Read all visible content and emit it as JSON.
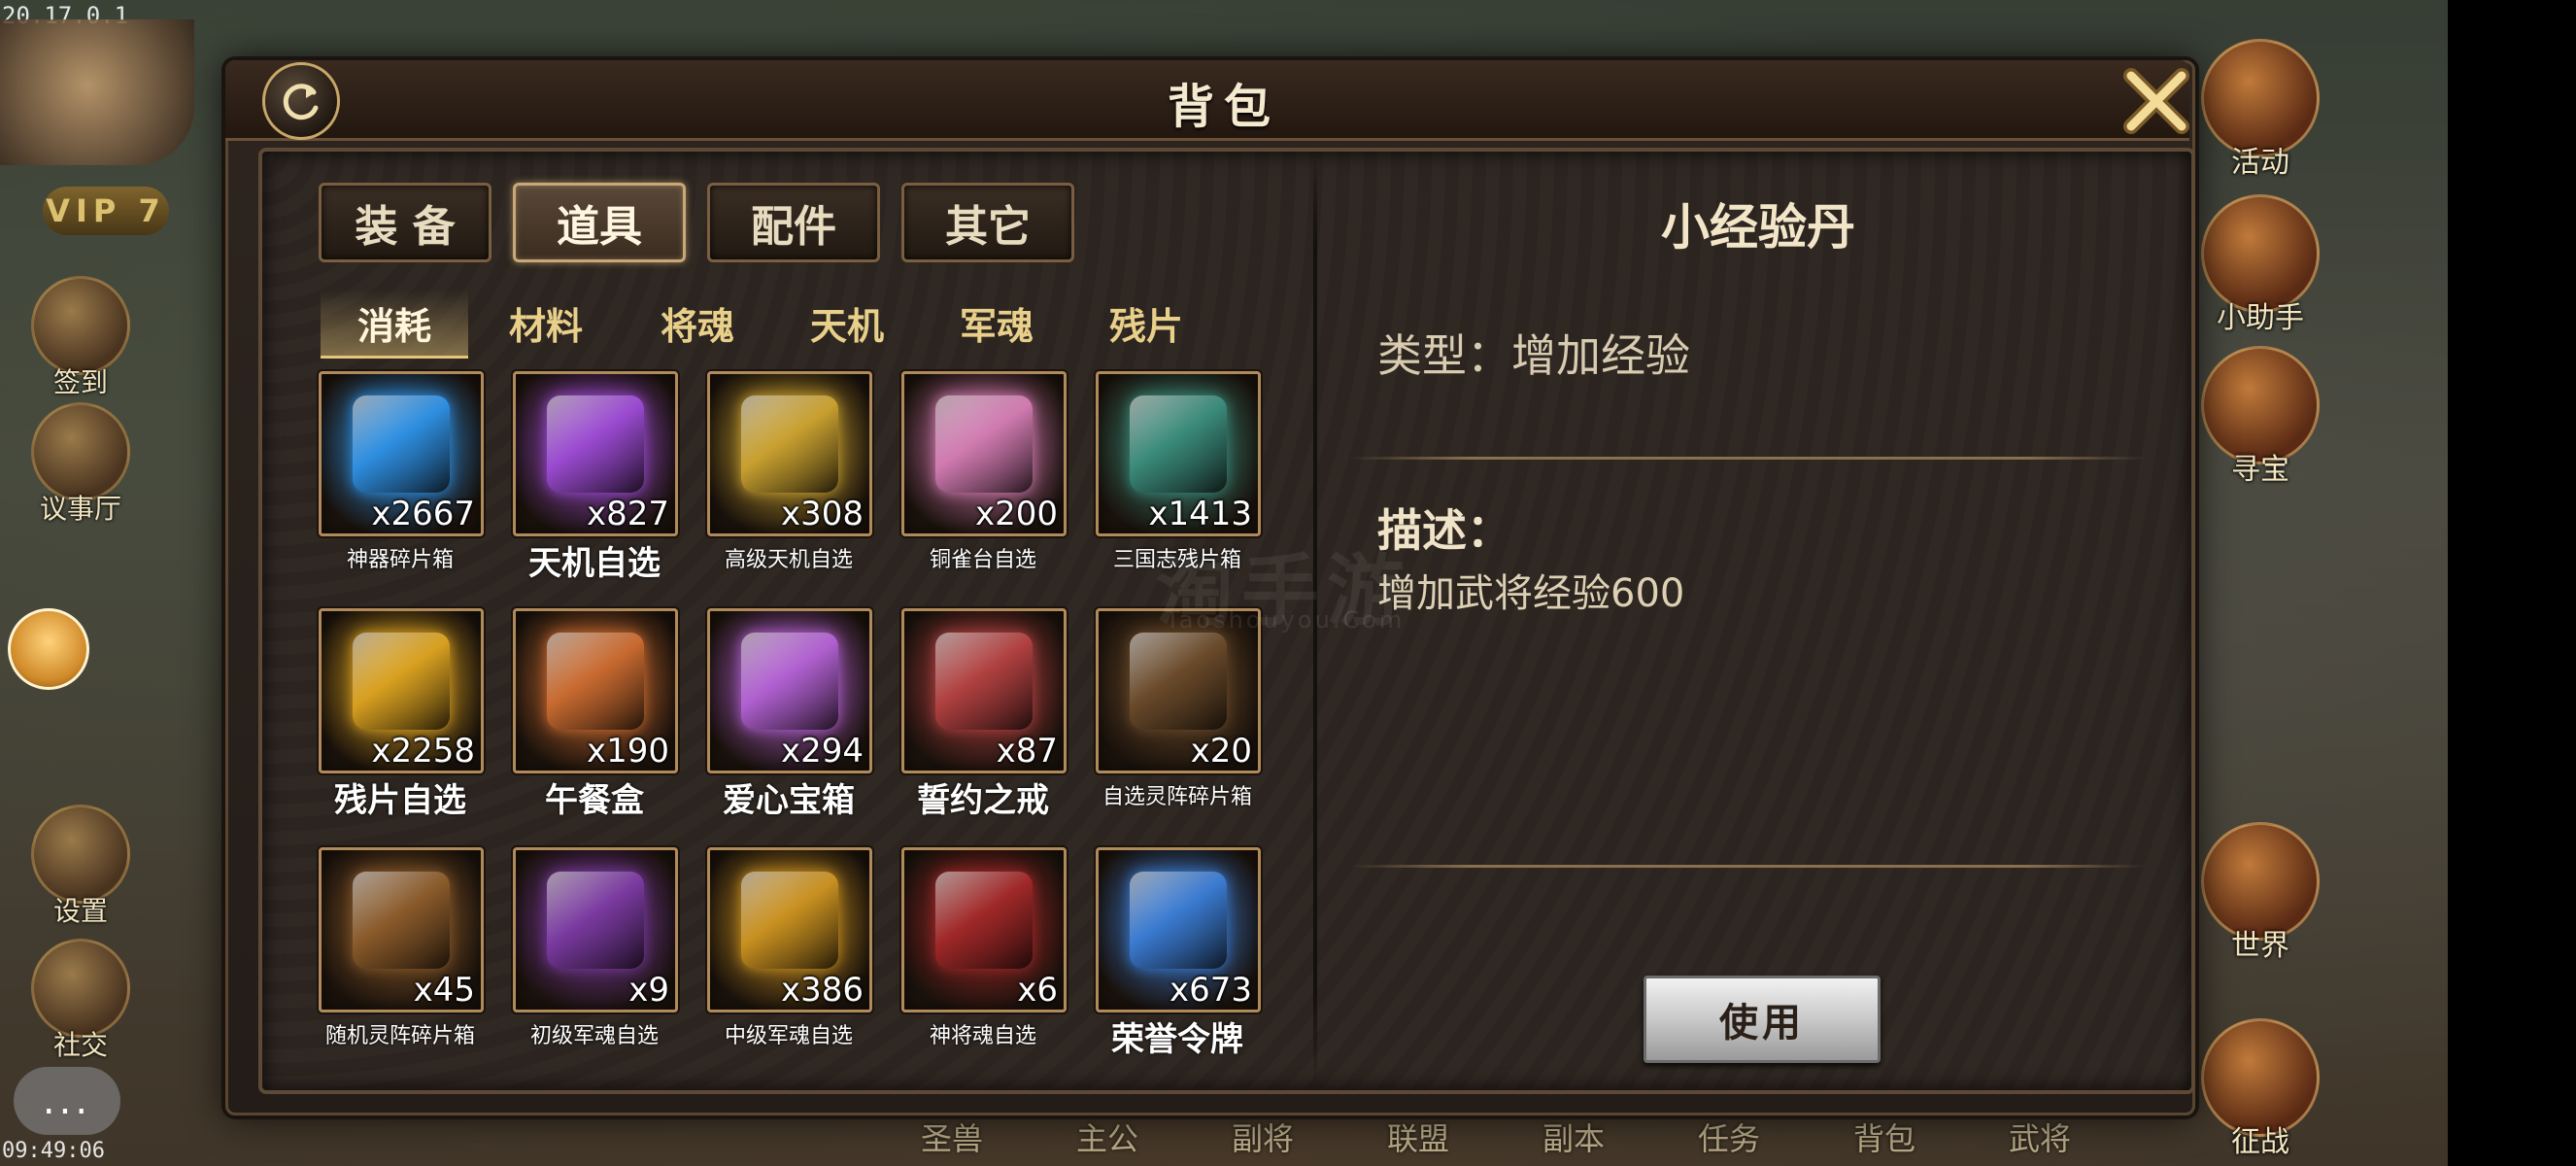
{
  "system": {
    "ip": "20.17.0.1",
    "time": "09:49:06"
  },
  "hud": {
    "vip": "VIP 7",
    "left_buttons": [
      "签到",
      "议事厅",
      "设置",
      "社交"
    ],
    "right_buttons": [
      "活动",
      "小助手",
      "寻宝",
      "世界",
      "征战"
    ],
    "bottom_bar": [
      "圣兽",
      "主公",
      "副将",
      "联盟",
      "副本",
      "任务",
      "背包",
      "武将"
    ],
    "chat": "..."
  },
  "panel": {
    "title": "背包",
    "tabs": [
      {
        "label": "装 备",
        "active": false
      },
      {
        "label": "道具",
        "active": true
      },
      {
        "label": "配件",
        "active": false
      },
      {
        "label": "其它",
        "active": false
      }
    ],
    "subtabs": [
      {
        "label": "消耗",
        "active": true
      },
      {
        "label": "材料",
        "active": false
      },
      {
        "label": "将魂",
        "active": false
      },
      {
        "label": "天机",
        "active": false
      },
      {
        "label": "军魂",
        "active": false
      },
      {
        "label": "残片",
        "active": false
      }
    ],
    "items": [
      {
        "name": "神器碎片箱",
        "qty": "x2667",
        "icon": "blue-crystal-icon",
        "color": "#2e8ee0",
        "size": "sm"
      },
      {
        "name": "天机自选",
        "qty": "x827",
        "icon": "purple-chest-icon",
        "color": "#9a4ad0",
        "size": "lg"
      },
      {
        "name": "高级天机自选",
        "qty": "x308",
        "icon": "gold-chest-icon",
        "color": "#c8a030",
        "size": "sm"
      },
      {
        "name": "铜雀台自选",
        "qty": "x200",
        "icon": "pink-chest-icon",
        "color": "#d07ab0",
        "size": "sm"
      },
      {
        "name": "三国志残片箱",
        "qty": "x1413",
        "icon": "scroll-icon",
        "color": "#3a8a7a",
        "size": "sm"
      },
      {
        "name": "残片自选",
        "qty": "x2258",
        "icon": "golden-box-icon",
        "color": "#d8a020",
        "size": "lg"
      },
      {
        "name": "午餐盒",
        "qty": "x190",
        "icon": "lunch-box-icon",
        "color": "#c86a30",
        "size": "lg"
      },
      {
        "name": "爱心宝箱",
        "qty": "x294",
        "icon": "heart-chest-icon",
        "color": "#b060d0",
        "size": "lg"
      },
      {
        "name": "誓约之戒",
        "qty": "x87",
        "icon": "ring-icon",
        "color": "#b04040",
        "size": "lg"
      },
      {
        "name": "自选灵阵碎片箱",
        "qty": "x20",
        "icon": "hexagon-box-icon",
        "color": "#6a4a2a",
        "size": "sm"
      },
      {
        "name": "随机灵阵碎片箱",
        "qty": "x45",
        "icon": "mystery-box-icon",
        "color": "#8a5a2a",
        "size": "sm"
      },
      {
        "name": "初级军魂自选",
        "qty": "x9",
        "icon": "purple-gold-chest-icon",
        "color": "#7a3aa0",
        "size": "sm"
      },
      {
        "name": "中级军魂自选",
        "qty": "x386",
        "icon": "gold-treasure-chest-icon",
        "color": "#c89020",
        "size": "sm"
      },
      {
        "name": "神将魂自选",
        "qty": "x6",
        "icon": "red-box-icon",
        "color": "#a02828",
        "size": "sm"
      },
      {
        "name": "荣誉令牌",
        "qty": "x673",
        "icon": "honor-token-icon",
        "color": "#3a7ad0",
        "size": "lg"
      }
    ],
    "detail": {
      "name": "小经验丹",
      "type": "类型：增加经验",
      "desc_label": "描述：",
      "desc": "增加武将经验600",
      "use_button": "使用"
    },
    "watermark": "淘手游",
    "watermark_sub": "Taoshouyou.Com"
  }
}
